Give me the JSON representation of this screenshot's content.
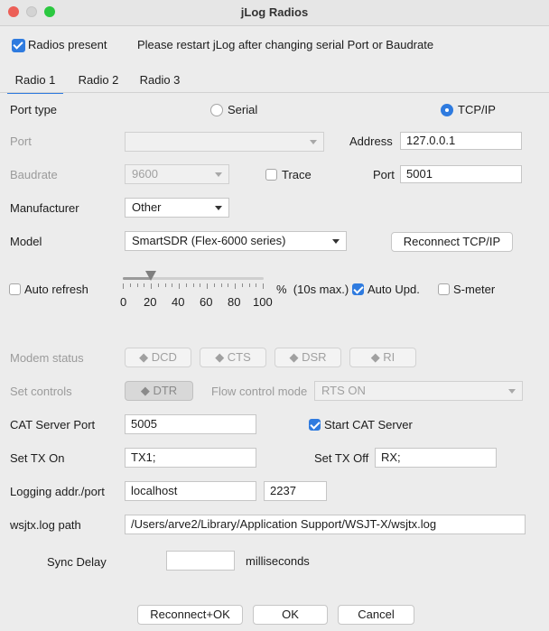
{
  "window": {
    "title": "jLog Radios"
  },
  "top": {
    "radios_present_label": "Radios present",
    "radios_present_checked": true,
    "notice": "Please restart jLog after changing serial Port or Baudrate"
  },
  "tabs": [
    {
      "label": "Radio 1",
      "active": true
    },
    {
      "label": "Radio 2",
      "active": false
    },
    {
      "label": "Radio 3",
      "active": false
    }
  ],
  "port_type": {
    "label": "Port type",
    "serial_label": "Serial",
    "tcpip_label": "TCP/IP",
    "selected": "TCP/IP"
  },
  "port": {
    "label": "Port",
    "value": ""
  },
  "address": {
    "label": "Address",
    "value": "127.0.0.1"
  },
  "baudrate": {
    "label": "Baudrate",
    "value": "9600"
  },
  "trace": {
    "label": "Trace",
    "checked": false
  },
  "tcp_port": {
    "label": "Port",
    "value": "5001"
  },
  "manufacturer": {
    "label": "Manufacturer",
    "value": "Other"
  },
  "model": {
    "label": "Model",
    "value": "SmartSDR (Flex-6000 series)"
  },
  "reconnect_tcp": {
    "label": "Reconnect TCP/IP"
  },
  "auto_refresh": {
    "label": "Auto refresh",
    "checked": false,
    "slider_value": 20,
    "slider_labels": [
      "0",
      "20",
      "40",
      "60",
      "80",
      "100"
    ],
    "unit_text": "%  (10s max.)"
  },
  "auto_upd": {
    "label": "Auto Upd.",
    "checked": true
  },
  "smeter": {
    "label": "S-meter",
    "checked": false
  },
  "modem_status": {
    "label": "Modem status",
    "dcd": "DCD",
    "cts": "CTS",
    "dsr": "DSR",
    "ri": "RI"
  },
  "set_controls": {
    "label": "Set controls",
    "dtr": "DTR"
  },
  "flow_control": {
    "label": "Flow control mode",
    "value": "RTS ON"
  },
  "cat_server": {
    "port_label": "CAT Server Port",
    "port_value": "5005",
    "start_label": "Start CAT Server",
    "start_checked": true
  },
  "tx_on": {
    "label": "Set TX On",
    "value": "TX1;"
  },
  "tx_off": {
    "label": "Set TX Off",
    "value": "RX;"
  },
  "logging": {
    "label": "Logging addr./port",
    "addr": "localhost",
    "port": "2237"
  },
  "wsjtx": {
    "label": "wsjtx.log path",
    "value": "/Users/arve2/Library/Application Support/WSJT-X/wsjtx.log"
  },
  "sync_delay": {
    "label": "Sync Delay",
    "value": "",
    "unit": "milliseconds"
  },
  "buttons": {
    "reconnect_ok": "Reconnect+OK",
    "ok": "OK",
    "cancel": "Cancel"
  },
  "colors": {
    "accent": "#2f7bdf",
    "close": "#ec5f57",
    "minimize": "#d3d3d3",
    "zoom": "#2bc840"
  }
}
